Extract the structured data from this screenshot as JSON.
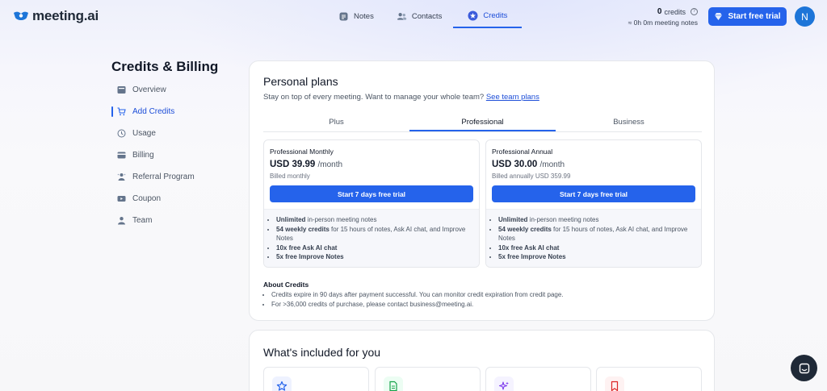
{
  "brand": {
    "name": "meeting.ai",
    "color": "#2563eb"
  },
  "nav": {
    "tabs": [
      {
        "label": "Notes",
        "icon": "notes-icon",
        "active": false
      },
      {
        "label": "Contacts",
        "icon": "contacts-icon",
        "active": false
      },
      {
        "label": "Credits",
        "icon": "credits-icon",
        "active": true
      }
    ]
  },
  "account": {
    "credits_count": "0",
    "credits_label": "credits",
    "meeting_notes": "≈ 0h 0m meeting notes",
    "trial_button": "Start free trial",
    "avatar_initial": "N"
  },
  "sidebar": {
    "title": "Credits & Billing",
    "items": [
      {
        "label": "Overview",
        "icon": "overview-icon",
        "active": false
      },
      {
        "label": "Add Credits",
        "icon": "cart-icon",
        "active": true
      },
      {
        "label": "Usage",
        "icon": "history-icon",
        "active": false
      },
      {
        "label": "Billing",
        "icon": "billing-icon",
        "active": false
      },
      {
        "label": "Referral Program",
        "icon": "referral-icon",
        "active": false
      },
      {
        "label": "Coupon",
        "icon": "coupon-icon",
        "active": false
      },
      {
        "label": "Team",
        "icon": "team-icon",
        "active": false
      }
    ]
  },
  "plans": {
    "title": "Personal plans",
    "subtitle": "Stay on top of every meeting. Want to manage your whole team?",
    "team_link": "See team plans",
    "tabs": [
      {
        "label": "Plus",
        "active": false
      },
      {
        "label": "Professional",
        "active": true
      },
      {
        "label": "Business",
        "active": false
      }
    ],
    "cards": [
      {
        "name": "Professional Monthly",
        "price": "USD 39.99",
        "period": "/month",
        "billed": "Billed monthly",
        "button": "Start 7 days free trial",
        "features": [
          {
            "bold": "Unlimited",
            "text": " in-person meeting notes"
          },
          {
            "bold": "54 weekly credits",
            "text": " for 15 hours of notes, Ask AI chat, and Improve Notes"
          },
          {
            "bold": "10x free Ask AI chat",
            "text": ""
          },
          {
            "bold": "5x free Improve Notes",
            "text": ""
          }
        ]
      },
      {
        "name": "Professional Annual",
        "price": "USD 30.00",
        "period": "/month",
        "billed": "Billed annually USD 359.99",
        "button": "Start 7 days free trial",
        "features": [
          {
            "bold": "Unlimited",
            "text": " in-person meeting notes"
          },
          {
            "bold": "54 weekly credits",
            "text": " for 15 hours of notes, Ask AI chat, and Improve Notes"
          },
          {
            "bold": "10x free Ask AI chat",
            "text": ""
          },
          {
            "bold": "5x free Improve Notes",
            "text": ""
          }
        ]
      }
    ],
    "about_title": "About Credits",
    "about_items": [
      "Credits expire in 90 days after payment successful. You can monitor credit expiration from credit page.",
      "For >36,000 credits of purchase, please contact business@meeting.ai."
    ]
  },
  "included": {
    "title": "What's included for you",
    "items": [
      {
        "icon": "star-icon",
        "color": "#2563eb"
      },
      {
        "icon": "document-icon",
        "color": "#16a34a"
      },
      {
        "icon": "sparkles-icon",
        "color": "#7c3aed"
      },
      {
        "icon": "bookmark-icon",
        "color": "#dc2626"
      }
    ]
  }
}
